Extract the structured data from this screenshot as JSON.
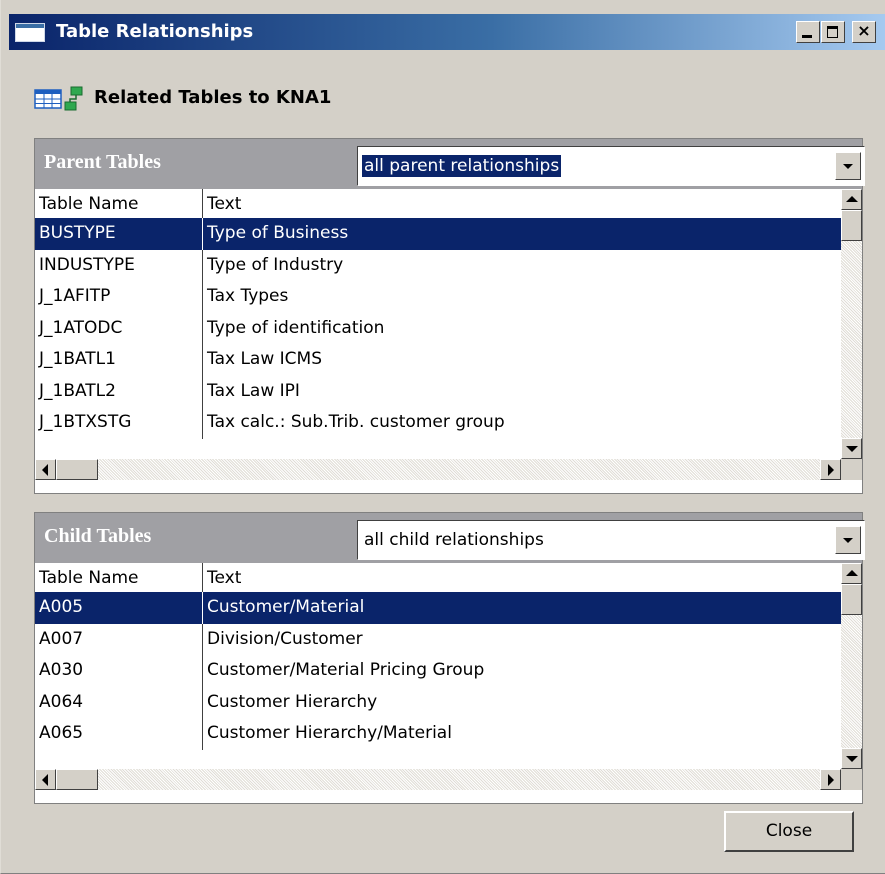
{
  "window": {
    "title": "Table Relationships",
    "close_glyph": "×"
  },
  "header": {
    "title": "Related Tables to KNA1",
    "icon": "table-relationship-icon"
  },
  "parent": {
    "title": "Parent Tables",
    "filter": "all parent relationships",
    "columns": [
      "Table Name",
      "Text"
    ],
    "rows": [
      {
        "name": "BUSTYPE",
        "text": "Type of Business",
        "selected": true
      },
      {
        "name": "INDUSTYPE",
        "text": "Type of Industry"
      },
      {
        "name": "J_1AFITP",
        "text": "Tax Types"
      },
      {
        "name": "J_1ATODC",
        "text": "Type of identification"
      },
      {
        "name": "J_1BATL1",
        "text": "Tax Law ICMS"
      },
      {
        "name": "J_1BATL2",
        "text": "Tax Law IPI"
      },
      {
        "name": "J_1BTXSTG",
        "text": "Tax calc.: Sub.Trib. customer group"
      }
    ]
  },
  "child": {
    "title": "Child Tables",
    "filter": "all child relationships",
    "columns": [
      "Table Name",
      "Text"
    ],
    "rows": [
      {
        "name": "A005",
        "text": "Customer/Material",
        "selected": true
      },
      {
        "name": "A007",
        "text": "Division/Customer"
      },
      {
        "name": "A030",
        "text": "Customer/Material Pricing Group"
      },
      {
        "name": "A064",
        "text": "Customer Hierarchy"
      },
      {
        "name": "A065",
        "text": "Customer Hierarchy/Material"
      }
    ]
  },
  "footer": {
    "close_label": "Close"
  },
  "colors": {
    "selection": "#0a246a",
    "panel_header": "#a0a0a4",
    "face": "#d4d0c8"
  }
}
